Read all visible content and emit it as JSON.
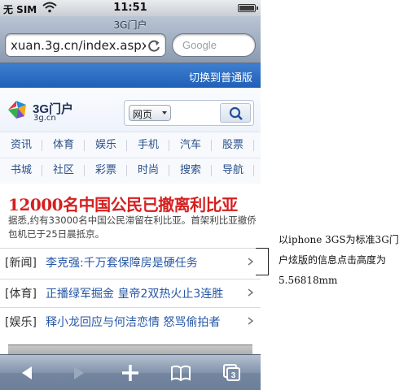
{
  "status_bar": {
    "carrier": "无 SIM",
    "time": "11:51"
  },
  "browser": {
    "page_title": "3G门户",
    "url": "xuan.3g.cn/index.aspx…",
    "search_placeholder": "Google"
  },
  "site": {
    "switch_link": "切换到普通版",
    "logo_name": "3G门户",
    "logo_domain": "3g.cn",
    "search_scope": "网页",
    "nav_row1": [
      "资讯",
      "体育",
      "娱乐",
      "手机",
      "汽车",
      "股票"
    ],
    "nav_row2": [
      "书城",
      "社区",
      "彩票",
      "时尚",
      "搜索",
      "导航"
    ],
    "headline": "12000名中国公民已撤离利比亚",
    "summary": "据悉,约有33000名中国公民滞留在利比亚。首架利比亚撤侨包机已于25日晨抵京。",
    "news": [
      {
        "tag": "[新闻]",
        "title": "李克强:千万套保障房是硬任务"
      },
      {
        "tag": "[体育]",
        "title": "正播绿军掘金 皇帝2双热火止3连胜"
      },
      {
        "tag": "[娱乐]",
        "title": "释小龙回应与何洁恋情 怒骂偷拍者"
      }
    ]
  },
  "toolbar": {
    "tabs_count": "3"
  },
  "annotation": {
    "text": "以iphone 3GS为标准3G门户炫版的信息点击高度为5.56818mm"
  },
  "colors": {
    "headline": "#d61f1f",
    "link": "#2456a6",
    "switch_bar": "#2a6ac4"
  }
}
